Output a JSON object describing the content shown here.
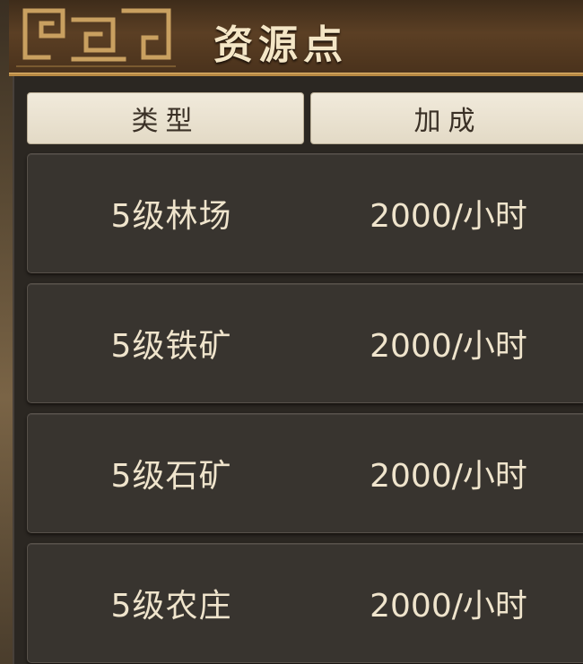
{
  "header": {
    "title": "资源点"
  },
  "table": {
    "columns": [
      "类型",
      "加成"
    ],
    "rows": [
      {
        "type": "5级林场",
        "bonus": "2000/小时"
      },
      {
        "type": "5级铁矿",
        "bonus": "2000/小时"
      },
      {
        "type": "5级石矿",
        "bonus": "2000/小时"
      },
      {
        "type": "5级农庄",
        "bonus": "2000/小时"
      }
    ]
  },
  "colors": {
    "header_gold": "#b88a45",
    "title_text": "#f4e6c6",
    "row_bg": "#38342f",
    "column_header_bg": "#f1eadb"
  }
}
